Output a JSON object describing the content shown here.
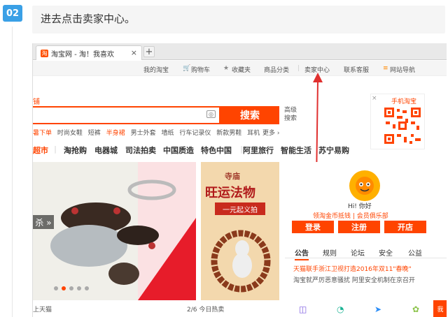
{
  "step": {
    "number": "02",
    "instruction": "进去点击卖家中心。"
  },
  "browser": {
    "tab_title": "淘宝网 - 淘！我喜欢",
    "tab_close": "×",
    "new_tab": "+"
  },
  "site_nav": {
    "my_taobao": "我的淘宝",
    "cart": "购物车",
    "favorites": "收藏夹",
    "categories": "商品分类",
    "seller_center": "卖家中心",
    "customer_service": "联系客服",
    "site_map": "网站导航"
  },
  "search": {
    "brand_tail": "铺",
    "button": "搜索",
    "advanced": "高级搜索",
    "hot_words": [
      {
        "text": "暑下单",
        "highlight": true
      },
      {
        "text": "时尚女鞋",
        "highlight": false
      },
      {
        "text": "短裤",
        "highlight": false
      },
      {
        "text": "半身裙",
        "highlight": true
      },
      {
        "text": "男士外套",
        "highlight": false
      },
      {
        "text": "墙纸",
        "highlight": false
      },
      {
        "text": "行车记录仪",
        "highlight": false
      },
      {
        "text": "新款男鞋",
        "highlight": false
      },
      {
        "text": "耳机",
        "highlight": false
      }
    ],
    "more": "更多 ›"
  },
  "mobile_taobao": {
    "label": "手机淘宝",
    "close": "×"
  },
  "category_nav": [
    "超市",
    "淘抢购",
    "电器城",
    "司法拍卖",
    "中国质造",
    "特色中国",
    "阿里旅行",
    "智能生活",
    "苏宁易购"
  ],
  "banner_left": {
    "tag": "杀 »"
  },
  "banner_mid": {
    "line1": "寺庙",
    "line2": "旺运法物",
    "line3": "一元起义拍"
  },
  "user_panel": {
    "greeting": "Hi! 你好",
    "coin_link": "领淘金币抵钱 | 会员俱乐部",
    "login": "登录",
    "register": "注册",
    "open_shop": "开店"
  },
  "notice_tabs": [
    "公告",
    "规则",
    "论坛",
    "安全",
    "公益"
  ],
  "news": [
    "天猫联手浙江卫视打造2016年双11\"春晚\"",
    "淘宝就严厉恶意骚扰  阿里安全机制在京召开"
  ],
  "bottom": {
    "left": "上天猫",
    "mid": "2/6  今日热卖",
    "side_tab": "我"
  },
  "colors": {
    "accent": "#ff4400",
    "step_badge": "#3aa0e6",
    "arrow": "#e0302f"
  }
}
